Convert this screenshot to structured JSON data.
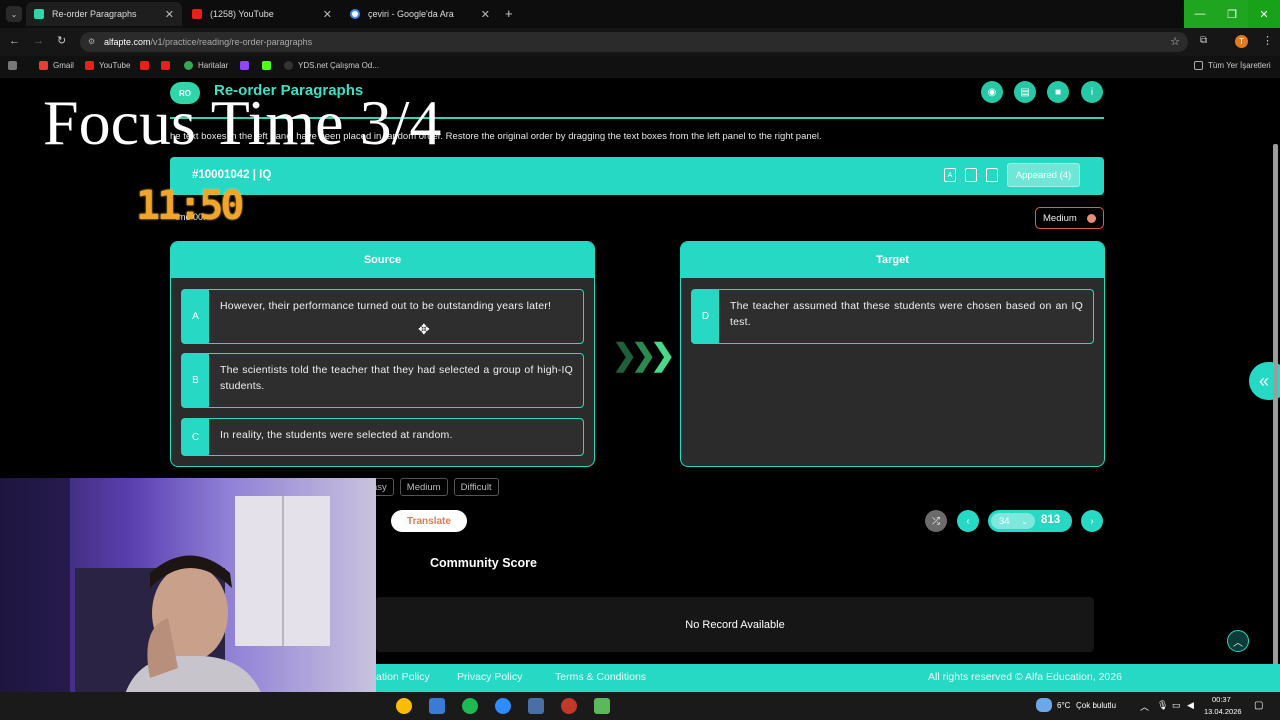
{
  "browser": {
    "tabs": [
      {
        "title": "Re-order Paragraphs",
        "active": true
      },
      {
        "title": "(1258) YouTube",
        "active": false
      },
      {
        "title": "çeviri - Google'da Ara",
        "active": false
      }
    ],
    "url_host": "alfapte.com",
    "url_path": "/v1/practice/reading/re-order-paragraphs",
    "bookmarks": [
      "Gmail",
      "YouTube",
      "Haritalar",
      "YDS.net Çalışma Od..."
    ],
    "all_bookmarks_label": "Tüm Yer İşaretleri",
    "profile_initial": "T"
  },
  "overlay": {
    "focus_text": "Focus Time 3/4",
    "timer": "11:50",
    "time_label": "ime 00:"
  },
  "header": {
    "logo": "RO",
    "title": "Re-order Paragraphs"
  },
  "instructions_visible": "he text boxes in the left panel have been placed in random order. Restore the original order by dragging the text boxes from the left panel to the right panel.",
  "question": {
    "id": "#10001042 | IQ",
    "appeared": "Appeared (4)",
    "difficulty": "Medium"
  },
  "source": {
    "title": "Source",
    "items": [
      {
        "letter": "A",
        "text": "However, their performance turned out to be outstanding years later!"
      },
      {
        "letter": "B",
        "text": "The scientists told the teacher that they had selected a group of high-IQ students."
      },
      {
        "letter": "C",
        "text": "In reality, the students were selected at random."
      }
    ]
  },
  "target": {
    "title": "Target",
    "items": [
      {
        "letter": "D",
        "text": "The teacher assumed that these students were chosen based on an IQ test."
      }
    ]
  },
  "difficulty_options": [
    "asy",
    "Medium",
    "Difficult"
  ],
  "translate_label": "Translate",
  "pagination": {
    "current": "34",
    "total": "813"
  },
  "community": {
    "title": "Community Score",
    "empty_message": "No Record Available"
  },
  "footer": {
    "links": [
      "ation Policy",
      "Privacy Policy",
      "Terms & Conditions"
    ],
    "copyright": "All rights reserved © Alfa Education, 2026"
  },
  "taskbar": {
    "weather_temp": "6°C",
    "weather_desc": "Çok bulutlu",
    "time": "00:37",
    "date": "13.04.2026"
  },
  "colors": {
    "accent": "#26d9c5",
    "timer": "#f2a52a",
    "translate_text": "#e07a52",
    "difficulty_border": "#e25e4b"
  }
}
